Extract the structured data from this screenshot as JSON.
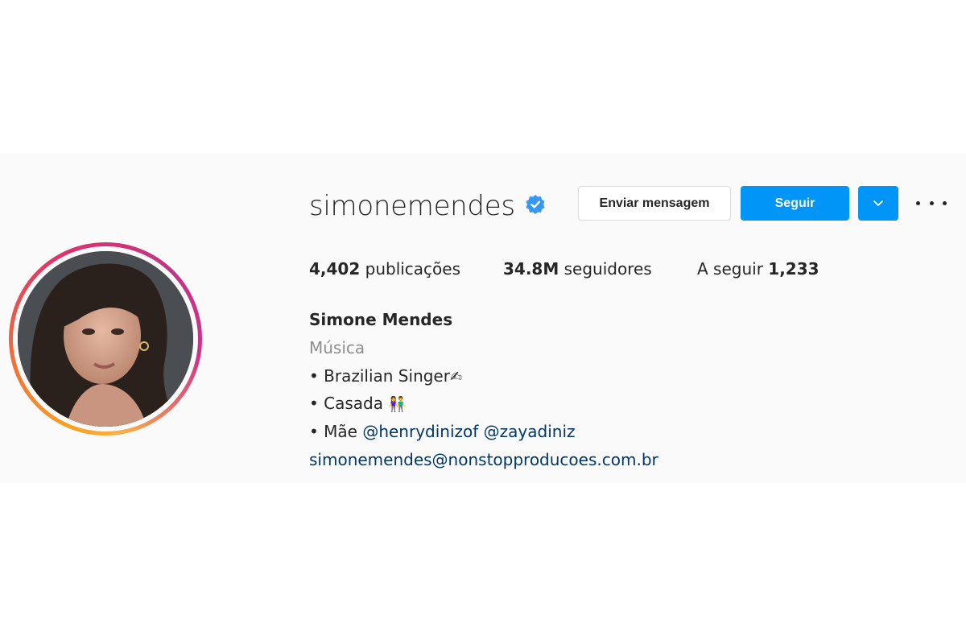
{
  "profile": {
    "username": "simonemendes",
    "verified": true,
    "avatar_alt": "simonemendes profile picture"
  },
  "actions": {
    "message_label": "Enviar mensagem",
    "follow_label": "Seguir",
    "dropdown_icon": "chevron-down-icon",
    "more_icon": "more-options-icon"
  },
  "stats": {
    "posts_count": "4,402",
    "posts_label": "publicações",
    "followers_count": "34.8M",
    "followers_label": "seguidores",
    "following_label": "A seguir",
    "following_count": "1,233"
  },
  "bio": {
    "full_name": "Simone Mendes",
    "category": "Música",
    "line1": "• Brazilian Singer",
    "line1_emoji": "✍",
    "line2": "• Casada ",
    "line2_emoji": "👫",
    "line3_prefix": "• Mãe ",
    "mention1": "@henrydinizof",
    "mention2": "@zayadiniz",
    "email": "simonemendes@nonstopproducoes.com.br"
  },
  "colors": {
    "accent": "#0095f6",
    "link": "#00376b",
    "verified": "#3897f0",
    "muted": "#8e8e8e",
    "text": "#262626"
  }
}
